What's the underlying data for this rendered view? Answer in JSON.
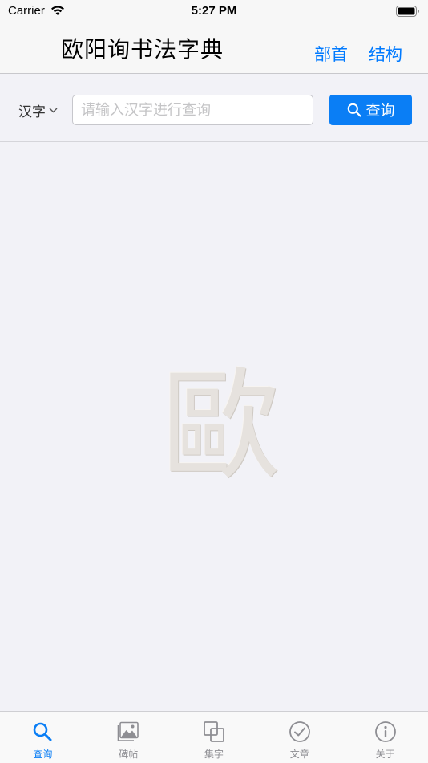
{
  "status_bar": {
    "carrier": "Carrier",
    "time": "5:27 PM"
  },
  "nav": {
    "title": "欧阳询书法字典",
    "radicals_label": "部首",
    "structure_label": "结构"
  },
  "search": {
    "mode": "汉字",
    "placeholder": "请输入汉字进行查询",
    "value": "",
    "button_label": "查询"
  },
  "logo": {
    "glyph": "歐"
  },
  "tabs": [
    {
      "label": "查询",
      "icon": "search-icon",
      "active": true
    },
    {
      "label": "碑帖",
      "icon": "photo-icon",
      "active": false
    },
    {
      "label": "集字",
      "icon": "overlap-squares-icon",
      "active": false
    },
    {
      "label": "文章",
      "icon": "checkmark-circle-icon",
      "active": false
    },
    {
      "label": "关于",
      "icon": "info-circle-icon",
      "active": false
    }
  ],
  "colors": {
    "accent": "#0a7ef5",
    "tab_inactive": "#8e8e93",
    "background": "#f2f2f7"
  }
}
